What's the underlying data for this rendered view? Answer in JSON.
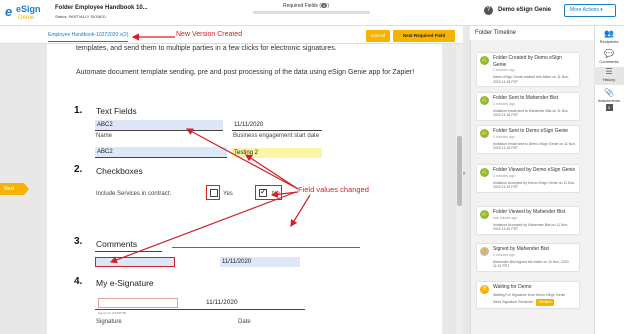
{
  "header": {
    "logo_word": "eSign",
    "logo_sub": "Genie",
    "folder_title": "Folder Employee Handbook 10...",
    "status_label": "Status: PARTIALLY SIGNED",
    "required_fields_label": "Required Fields (",
    "required_fields_count": "4",
    "required_fields_suffix": ")",
    "user_name": "Demo eSign Genie",
    "more_actions": "More Actions ▾"
  },
  "subbar": {
    "doc_tab": "Employee Handbook-10272020 v(2)",
    "cancel": "Cancel",
    "next_required": "Next Required Field"
  },
  "annotations": {
    "version": "New Version Created",
    "fields_changed": "Field values changed"
  },
  "document": {
    "intro_1": "templates, and send them to multiple parties in a few clicks for electronic signatures.",
    "intro_2": "Automate document template sending, pre and post processing of the data using eSign Genie app for Zapier!",
    "sections": [
      {
        "num": "1.",
        "title": "Text Fields"
      },
      {
        "num": "2.",
        "title": "Checkboxes"
      },
      {
        "num": "3.",
        "title": "Comments"
      },
      {
        "num": "4.",
        "title": "My e-Signature"
      }
    ],
    "name_value": "ABC2",
    "name_label": "Name",
    "date_value": "11/11/2020",
    "date_label": "Business engagement start date",
    "field2_value": "ABC2",
    "field3_value": "Testing 2",
    "include_label": "Include Services in contract:",
    "yes_label": "Yes",
    "no_label": "No",
    "comment_date": "11/11/2020",
    "sig_date": "11/11/2020",
    "signature_label": "Signature",
    "date_label_2": "Date",
    "signer_small": "Signer ID:123456789"
  },
  "side": {
    "next_flag": "Next"
  },
  "timeline": {
    "title": "Folder Timeline",
    "items": [
      {
        "title_a": "Folder Created by Demo eSign Genie",
        "time": "0 minutes ago",
        "desc": "Demo eSign Genie created this folder on 11 Nov, 2020 11:18 PST"
      },
      {
        "title_a": "Folder Sent to Mahender Bist",
        "time": "0 minutes ago",
        "desc": "Invitation email sent to Mahender Bist on 11 Nov, 2020 11:18 PST"
      },
      {
        "title_a": "Folder Sent to Demo eSign Genie",
        "time": "0 minutes ago",
        "desc": "Invitation email sent to Demo eSign Genie on 11 Nov, 2020 11:18 PST"
      },
      {
        "title_a": "Folder Viewed by Demo eSign Genie",
        "time": "0 minutes ago",
        "desc": "Invitation Accepted by Demo eSign Genie on 11 Nov, 2020 11:19 PST"
      },
      {
        "title_a": "Folder Viewed by Mahender Bist",
        "time": "one minute ago",
        "desc": "Invitation Accepted by Mahender Bist on 11 Nov, 2020 11:20 PST"
      },
      {
        "title_a": "Signed by Mahender Bist",
        "time": "0 minutes ago",
        "desc": "Mahender Bist signed the folder on 11 Nov, 2020 11:21 PST"
      },
      {
        "title_a": "Waiting for Demo",
        "desc": "Waiting For Signature from Demo eSign Genie",
        "remind_text": "Send Signature Reminder",
        "remind_btn": "Remind"
      }
    ]
  },
  "rail": {
    "recipients": "Recipients",
    "comments": "Comments",
    "history": "History",
    "attachments": "Attachments",
    "attachments_count": "0"
  },
  "colors": {
    "brand_blue": "#1b7ec2",
    "accent_yellow": "#f6b300",
    "annotation_red": "#d0202a",
    "field_blue": "#dde7f7",
    "field_yellow": "#fbf5a8",
    "timeline_green": "#7cc044"
  }
}
